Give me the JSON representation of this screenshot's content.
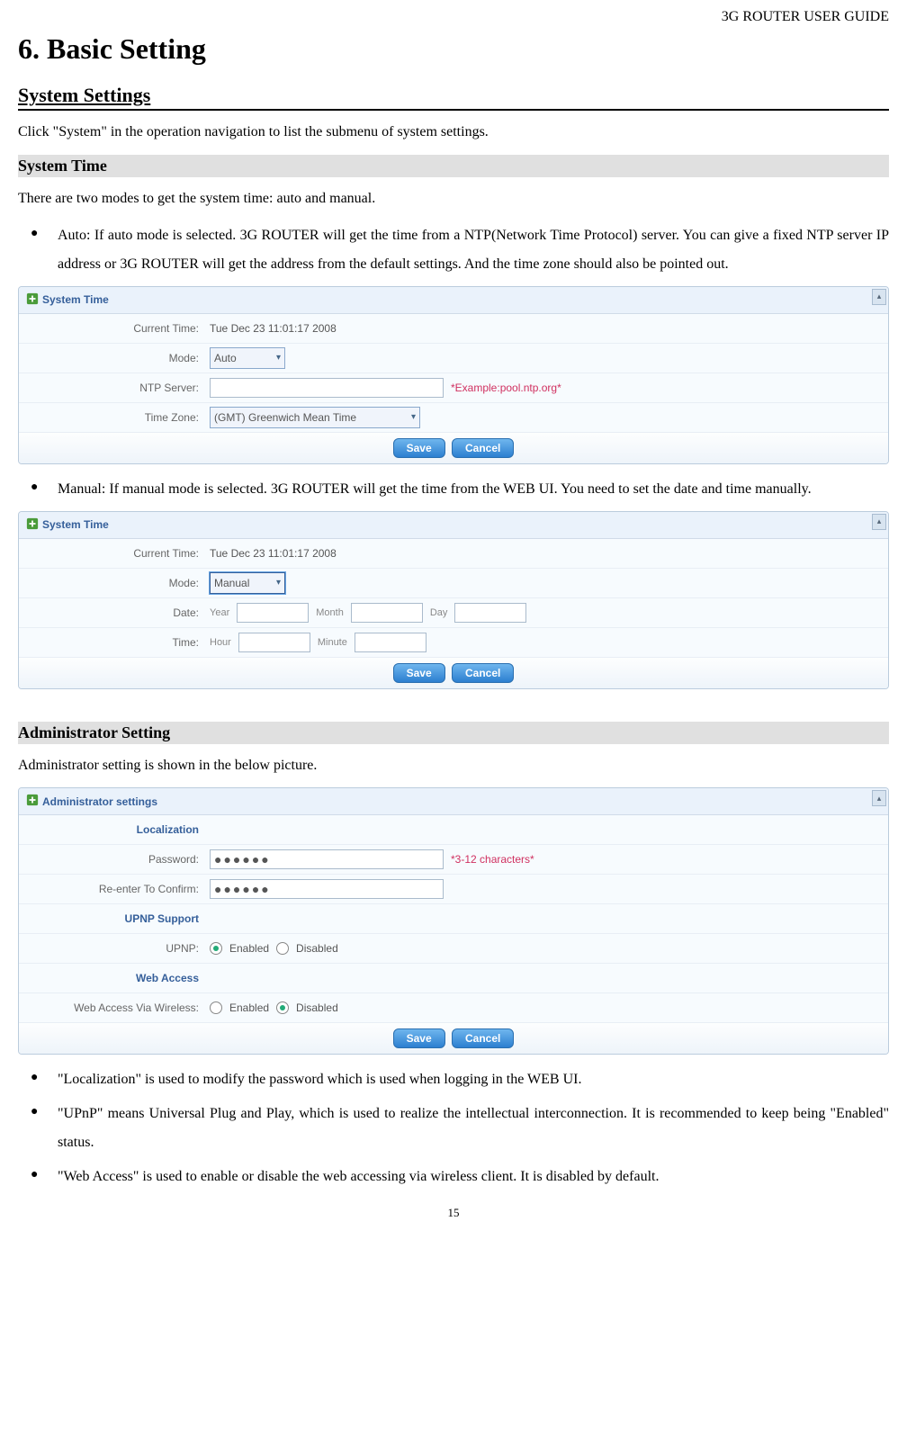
{
  "header": {
    "guide": "3G ROUTER USER GUIDE"
  },
  "h1": "6. Basic Setting",
  "section": {
    "title": "System Settings"
  },
  "intro": "Click \"System\" in the operation navigation to list the submenu of system settings.",
  "systime": {
    "heading": "System Time",
    "para": "There are two modes to get the system time: auto and manual.",
    "bullet_auto": "Auto: If auto mode is selected. 3G ROUTER will get the time from a NTP(Network Time Protocol) server. You can give a fixed NTP server IP address or 3G ROUTER will get the address from the default settings. And the time zone should also be pointed out.",
    "bullet_manual": "Manual: If manual mode is selected. 3G ROUTER will get the time from the WEB UI. You need to set the date and time manually."
  },
  "panel_auto": {
    "title": "System Time",
    "current_label": "Current Time:",
    "current_value": "Tue Dec 23 11:01:17 2008",
    "mode_label": "Mode:",
    "mode_value": "Auto",
    "ntp_label": "NTP Server:",
    "ntp_hint": "*Example:pool.ntp.org*",
    "tz_label": "Time Zone:",
    "tz_value": "(GMT) Greenwich Mean Time",
    "save": "Save",
    "cancel": "Cancel"
  },
  "panel_manual": {
    "title": "System Time",
    "current_label": "Current Time:",
    "current_value": "Tue Dec 23 11:01:17 2008",
    "mode_label": "Mode:",
    "mode_value": "Manual",
    "date_label": "Date:",
    "year": "Year",
    "month": "Month",
    "day": "Day",
    "time_label": "Time:",
    "hour": "Hour",
    "minute": "Minute",
    "save": "Save",
    "cancel": "Cancel"
  },
  "admin": {
    "heading": "Administrator Setting",
    "para": "Administrator setting is shown in the below picture.",
    "panel": {
      "title": "Administrator settings",
      "loc_heading": "Localization",
      "pw_label": "Password:",
      "pw_value": "●●●●●●",
      "pw_hint": "*3-12 characters*",
      "repw_label": "Re-enter To Confirm:",
      "repw_value": "●●●●●●",
      "upnp_heading": "UPNP Support",
      "upnp_label": "UPNP:",
      "enabled": "Enabled",
      "disabled": "Disabled",
      "webacc_heading": "Web Access",
      "webacc_label": "Web Access Via Wireless:",
      "save": "Save",
      "cancel": "Cancel"
    },
    "bullet_loc": "\"Localization\" is used to modify the password which is used when logging in the WEB UI.",
    "bullet_upnp": "\"UPnP\" means Universal Plug and Play, which is used to realize the intellectual interconnection. It is recommended to keep being \"Enabled\" status.",
    "bullet_web": "\"Web Access\" is used to enable or disable the web accessing via wireless client. It is disabled by default."
  },
  "page_number": "15"
}
